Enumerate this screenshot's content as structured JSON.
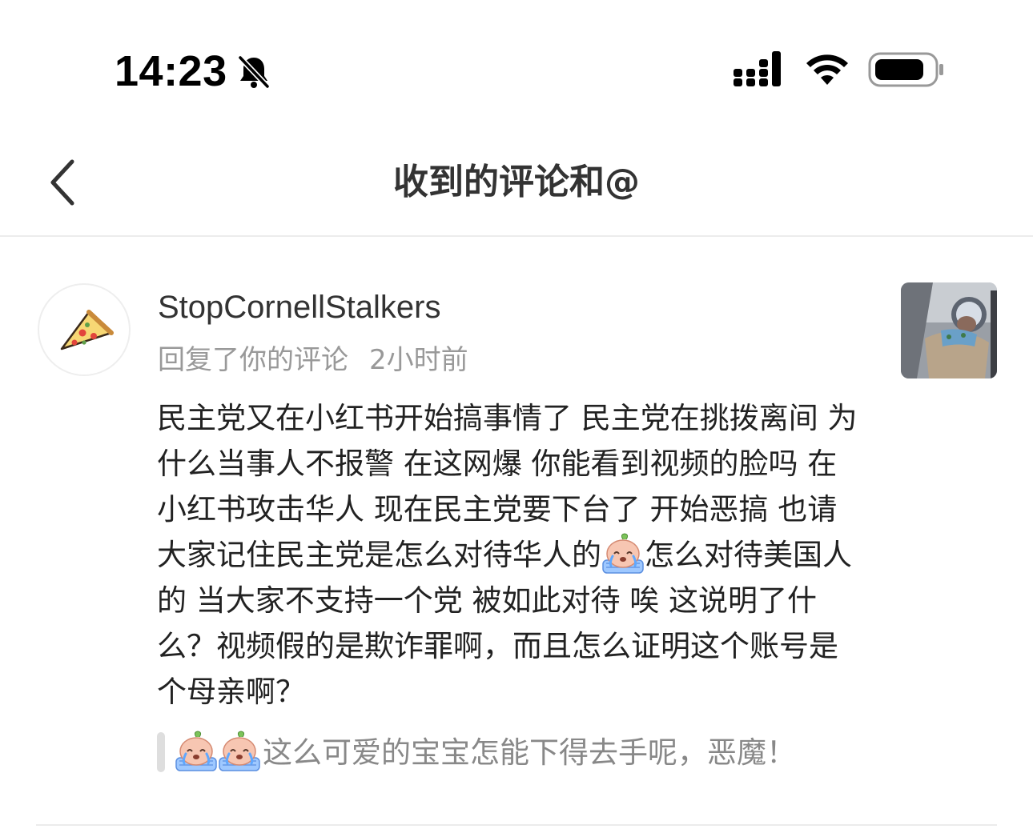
{
  "status_bar": {
    "time": "14:23",
    "icons": [
      "bell-slash-icon",
      "signal-icon",
      "wifi-icon",
      "battery-icon"
    ]
  },
  "nav": {
    "back_icon": "chevron-left-icon",
    "title": "收到的评论和@"
  },
  "comment": {
    "avatar_icon": "pizza-slice-icon",
    "username": "StopCornellStalkers",
    "action": "回复了你的评论",
    "time_ago": "2小时前",
    "body_part1": "民主党又在小红书开始搞事情了 民主党在挑拨离间 为什么当事人不报警 在这网爆 你能看到视频的脸吗 在小红书攻击华人 现在民主党要下台了 开始恶搞 也请大家记住民主党是怎么对待华人的",
    "body_emoji": "crying-peach-emoji",
    "body_part2": "怎么对待美国人的 当大家不支持一个党 被如此对待 唉 这说明了什么？视频假的是欺诈罪啊，而且怎么证明这个账号是个母亲啊？",
    "quoted_text": "这么可爱的宝宝怎能下得去手呢，恶魔！",
    "quoted_emojis": [
      "crying-peach-emoji",
      "crying-peach-emoji"
    ],
    "thumbnail": "baby-photo-thumbnail"
  },
  "colors": {
    "primary_text": "#222222",
    "secondary_text": "#999999",
    "quote_text": "#888888",
    "divider": "#ececec"
  }
}
